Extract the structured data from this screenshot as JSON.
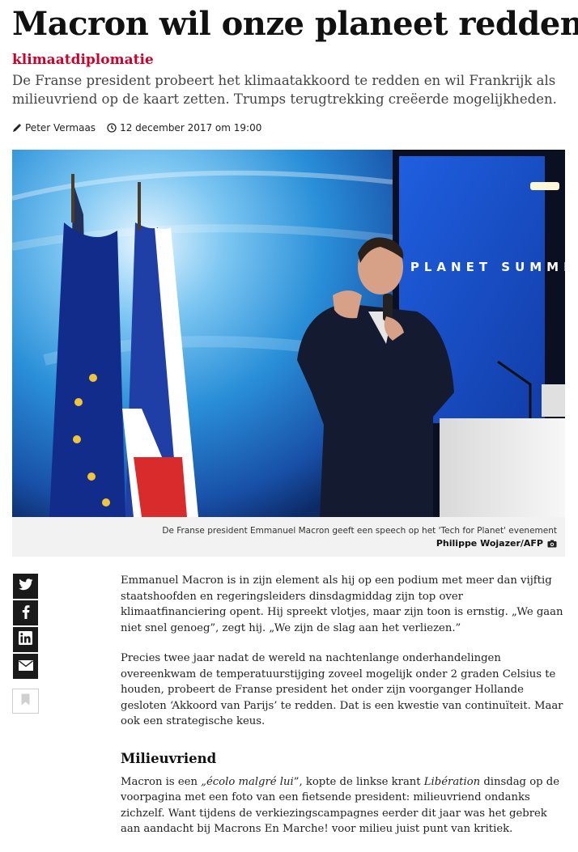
{
  "article": {
    "title": "Macron wil onze planeet redden",
    "kicker": "klimaatdiplomatie",
    "lead": "De Franse president probeert het klimaatakkoord te redden en wil Frankrijk als milieuvriend op de kaart zetten. Trumps terugtrekking creëerde mogelijkheden.",
    "author": "Peter Vermaas",
    "date": "12 december 2017 om 19:00",
    "author_icon": "pen-icon",
    "date_icon": "clock-icon"
  },
  "photo": {
    "screen_text": "ONE PLANET SUMMIT",
    "caption": "De Franse president Emmanuel Macron geeft een speech op het 'Tech for Planet' evenement",
    "credit": "Philippe Wojazer/AFP",
    "credit_icon": "camera-icon"
  },
  "share": {
    "buttons": [
      "twitter-icon",
      "facebook-icon",
      "linkedin-icon",
      "email-icon"
    ],
    "bookmark": "bookmark-icon"
  },
  "body": {
    "p1": "Emmanuel Macron is in zijn element als hij op een podium met meer dan vijftig staatshoofden en regeringsleiders dinsdagmiddag zijn top over klimaatfinanciering opent. Hij spreekt vlotjes, maar zijn toon is ernstig. „We gaan niet snel genoeg”, zegt hij. „We zijn de slag aan het verliezen.”",
    "p2": "Precies twee jaar nadat de wereld na nachtenlange onderhandelingen overeenkwam de temperatuurstijging zoveel mogelijk onder 2 graden Celsius te houden, probeert de Franse president het onder zijn voorganger Hollande gesloten ‘Akkoord van Parijs’ te redden. Dat is een kwestie van continuïteit. Maar ook een strategische keus.",
    "subheading": "Milieuvriend",
    "p3_a": "Macron is een ",
    "p3_quote": "„écolo malgré lui",
    "p3_b": "”, kopte de linkse krant ",
    "p3_paper": "Libération",
    "p3_c": " dinsdag op de voorpagina met een foto van een fietsende president: milieuvriend ondanks zichzelf. Want tijdens de verkiezingscampagnes eerder dit jaar was het gebrek aan aandacht bij Macrons En Marche! voor milieu juist punt van kritiek."
  }
}
